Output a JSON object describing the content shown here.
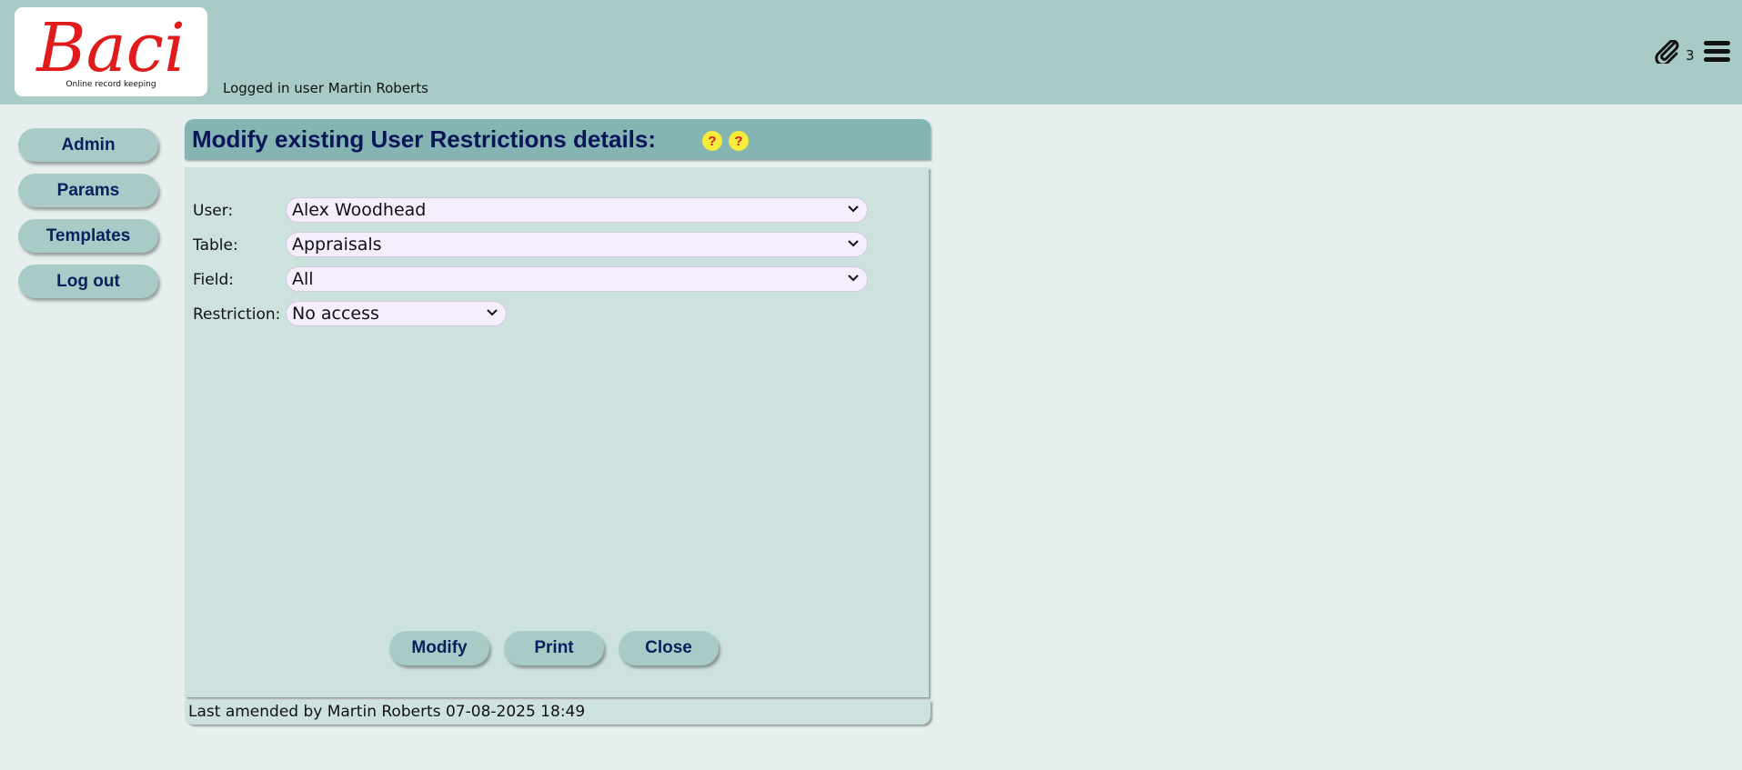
{
  "header": {
    "logo_text": "Baci",
    "logo_tagline": "Online record keeping",
    "logged_in": "Logged in user Martin Roberts",
    "attachments_count": "3",
    "attachment_icon": "paperclip-icon",
    "menu_icon": "hamburger-menu-icon"
  },
  "sidebar": {
    "items": [
      {
        "label": "Admin"
      },
      {
        "label": "Params"
      },
      {
        "label": "Templates"
      },
      {
        "label": "Log out"
      }
    ]
  },
  "form": {
    "title": "Modify existing User Restrictions details:",
    "help_icon": "help-question-icon",
    "fields": [
      {
        "label": "User:",
        "value": "Alex Woodhead"
      },
      {
        "label": "Table:",
        "value": "Appraisals"
      },
      {
        "label": "Field:",
        "value": "All"
      },
      {
        "label": "Restriction:",
        "value": "No access"
      }
    ],
    "buttons": {
      "modify": "Modify",
      "print": "Print",
      "close": "Close"
    },
    "footer": "Last amended by Martin Roberts 07-08-2025 18:49"
  },
  "colors": {
    "header_bg": "#a8cbc8",
    "page_bg": "#e6efed",
    "title_bar": "#85b5b2",
    "panel_bg": "#cde2df",
    "button_text": "#0a1f5c",
    "logo_red": "#e01b1b",
    "select_bg": "#f4eefd"
  }
}
